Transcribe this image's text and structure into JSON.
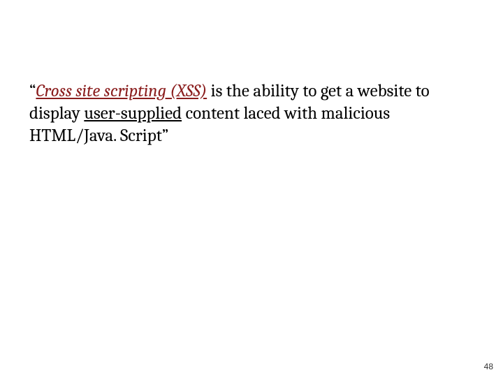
{
  "quote": {
    "open": "“",
    "term_emph": "Cross site scripting (XSS)",
    "text_middle_1": " is the ability to get a website to display ",
    "user_supplied": "user-supplied",
    "text_middle_2": " content laced with malicious HTML/Java. Script",
    "close": "”"
  },
  "page_number": "48"
}
